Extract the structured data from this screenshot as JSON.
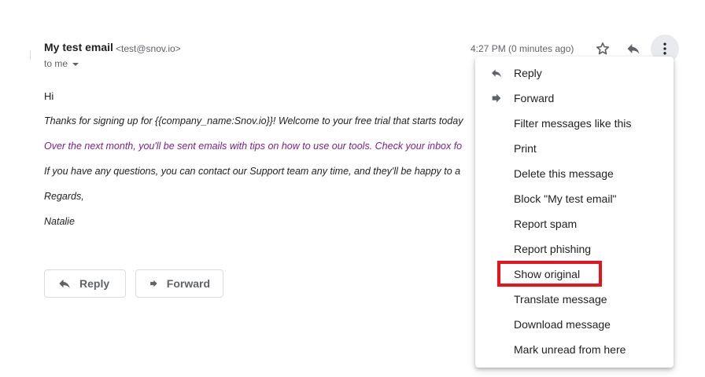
{
  "email": {
    "sender_name": "My test email",
    "sender_email": "<test@snov.io>",
    "recipient": "to me",
    "timestamp": "4:27 PM (0 minutes ago)",
    "greeting": "Hi",
    "lines": [
      "Thanks for signing up for {{company_name:Snov.io}}! Welcome to your free trial that starts today",
      "Over the next month, you'll be sent emails with tips on how to use our tools. Check your inbox fo",
      "If you have any questions, you can contact our Support team any time, and they'll be happy to a",
      "Regards,",
      "Natalie"
    ]
  },
  "actions": {
    "reply_label": "Reply",
    "forward_label": "Forward"
  },
  "menu": {
    "items": [
      {
        "label": "Reply",
        "icon": "reply-icon"
      },
      {
        "label": "Forward",
        "icon": "forward-icon"
      },
      {
        "label": "Filter messages like this"
      },
      {
        "label": "Print"
      },
      {
        "label": "Delete this message"
      },
      {
        "label": "Block \"My test email\""
      },
      {
        "label": "Report spam"
      },
      {
        "label": "Report phishing"
      },
      {
        "label": "Show original",
        "highlighted": true
      },
      {
        "label": "Translate message"
      },
      {
        "label": "Download message"
      },
      {
        "label": "Mark unread from here"
      }
    ]
  },
  "colors": {
    "highlight": "#e8141d",
    "purple_text": "#7b1f8f",
    "icon_gray": "#5f6368"
  }
}
